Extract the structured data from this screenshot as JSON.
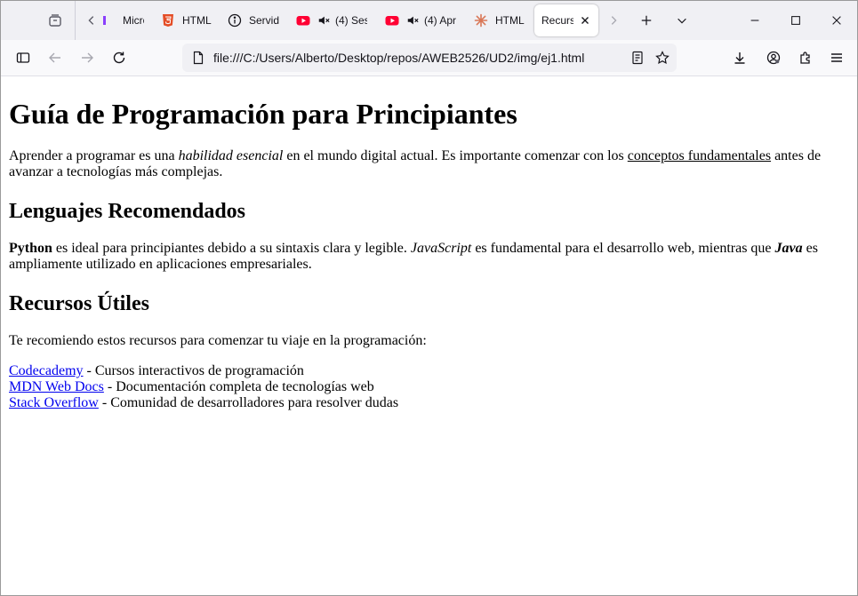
{
  "browser": {
    "tabs": [
      {
        "label": "Micros",
        "icon": "purple-app-icon"
      },
      {
        "label": "HTML",
        "icon": "html5-icon"
      },
      {
        "label": "Servid",
        "icon": "info-circle-icon"
      },
      {
        "label": "(4) Ses",
        "icon": "youtube-icon",
        "muted": true
      },
      {
        "label": "(4) Apr",
        "icon": "youtube-icon",
        "muted": true
      },
      {
        "label": "HTML",
        "icon": "claude-icon"
      },
      {
        "label": "Recurso",
        "icon": "none",
        "active": true
      }
    ],
    "url": "file:///C:/Users/Alberto/Desktop/repos/AWEB2526/UD2/img/ej1.html",
    "colors": {
      "accent": "#ff0000",
      "html5": "#e44d26",
      "claude": "#d97757",
      "tabstrip": "#f0f0f4"
    }
  },
  "page": {
    "title": "Guía de Programación para Principiantes",
    "intro": {
      "part1": "Aprender a programar es una ",
      "em1": "habilidad esencial",
      "part2": " en el mundo digital actual. Es importante comenzar con los ",
      "u1": "conceptos fundamentales",
      "part3": " antes de avanzar a tecnologías más complejas."
    },
    "section1": {
      "heading": "Lenguajes Recomendados",
      "b1": "Python",
      "t1": " es ideal para principiantes debido a su sintaxis clara y legible. ",
      "i1": "JavaScript",
      "t2": " es fundamental para el desarrollo web, mientras que ",
      "bi1": "Java",
      "t3": " es ampliamente utilizado en aplicaciones empresariales."
    },
    "section2": {
      "heading": "Recursos Útiles",
      "intro": "Te recomiendo estos recursos para comenzar tu viaje en la programación:",
      "links": [
        {
          "text": "Codecademy",
          "desc": " - Cursos interactivos de programación"
        },
        {
          "text": "MDN Web Docs",
          "desc": " - Documentación completa de tecnologías web"
        },
        {
          "text": "Stack Overflow",
          "desc": " - Comunidad de desarrolladores para resolver dudas"
        }
      ]
    }
  }
}
